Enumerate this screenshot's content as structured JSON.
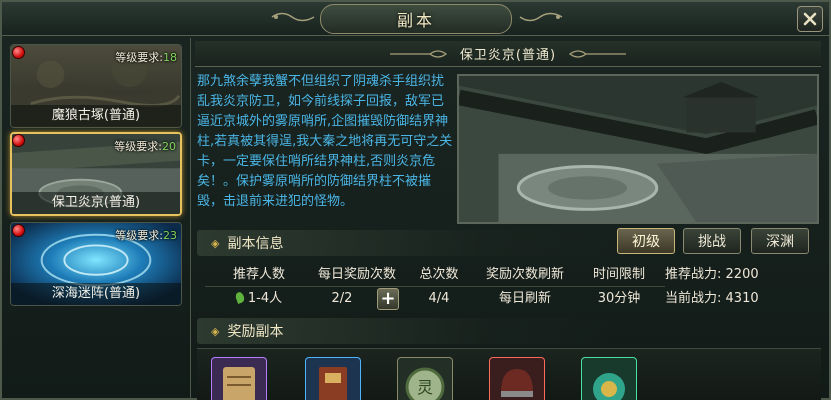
{
  "window": {
    "title": "副本"
  },
  "dungeons": [
    {
      "name": "魔狼古塚(普通)",
      "level_label": "等级要求:",
      "level": "18",
      "selected": false
    },
    {
      "name": "保卫炎京(普通)",
      "level_label": "等级要求:",
      "level": "20",
      "selected": true
    },
    {
      "name": "深海迷阵(普通)",
      "level_label": "等级要求:",
      "level": "23",
      "selected": false
    }
  ],
  "detail": {
    "name": "保卫炎京(普通)",
    "story": "那九煞余孽我蟹不但组织了阴魂杀手组织扰乱我炎京防卫，如今前线探子回报，敌军已逼近京城外的雾原哨所,企图摧毁防御结界神柱,若真被其得逞,我大秦之地将再无可守之关卡，一定要保住哨所结界神柱,否则炎京危矣！。保护雾原哨所的防御结界柱不被摧毁，击退前来进犯的怪物。"
  },
  "sections": {
    "info": "副本信息",
    "rewards": "奖励副本"
  },
  "difficulty": {
    "buttons": [
      "初级",
      "挑战",
      "深渊"
    ],
    "active": "初级"
  },
  "info_table": {
    "headers": [
      "推荐人数",
      "每日奖励次数",
      "总次数",
      "奖励次数刷新",
      "时间限制"
    ],
    "values": [
      "1-4人",
      "2/2",
      "4/4",
      "每日刷新",
      "30分钟"
    ],
    "recommended_power_label": "推荐战力:",
    "recommended_power": "2200",
    "current_power_label": "当前战力:",
    "current_power": "4310"
  },
  "colors": {
    "accent": "#e7c25e",
    "story_text": "#4ab6e6",
    "level_value": "#7fd55c"
  }
}
